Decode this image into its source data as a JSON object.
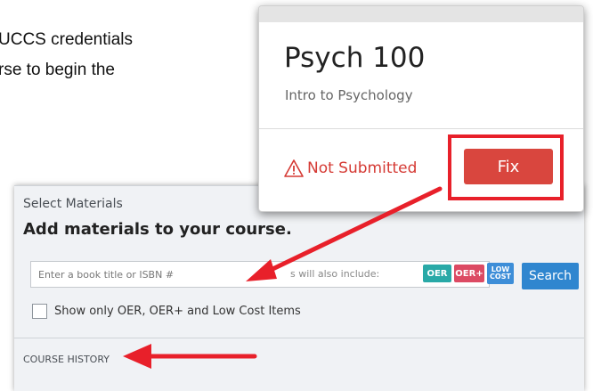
{
  "background_text": {
    "line1": "UCCS credentials",
    "line2": "rse to begin the"
  },
  "card": {
    "title": "Psych 100",
    "subtitle": "Intro to Psychology",
    "status": "Not Submitted",
    "fix_label": "Fix"
  },
  "panel": {
    "label": "Select Materials",
    "heading": "Add materials to your course.",
    "search_placeholder": "Enter a book title or ISBN #",
    "includes_text": "s will also include:",
    "badges": {
      "oer": "OER",
      "oer_plus": "OER+",
      "low_cost_line1": "LOW",
      "low_cost_line2": "COST"
    },
    "search_label": "Search",
    "filter_label": "Show only OER, OER+ and Low Cost Items",
    "history_label": "COURSE HISTORY"
  },
  "colors": {
    "annotation_red": "#e8202a",
    "fix_button": "#d9463e",
    "search_button": "#2f86cf",
    "oer": "#29a9a7",
    "oer_plus": "#dc4a63",
    "low_cost": "#3d8ed8"
  }
}
